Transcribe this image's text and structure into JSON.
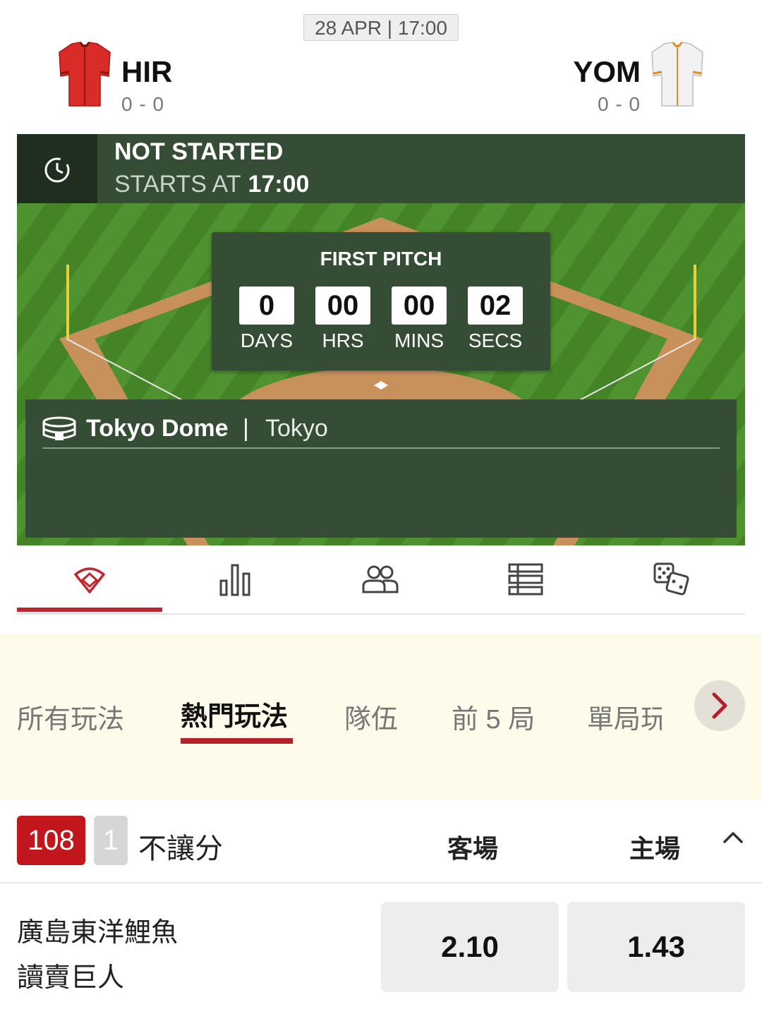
{
  "header": {
    "datetime": "28 APR | 17:00",
    "away_team": {
      "code": "HIR",
      "score": "0 - 0",
      "jersey_color": "#d92b27"
    },
    "home_team": {
      "code": "YOM",
      "score": "0 - 0",
      "jersey_color": "#f2f2f2"
    }
  },
  "status": {
    "title": "NOT STARTED",
    "starts_label": "STARTS AT",
    "start_time": "17:00",
    "icon": "clock-icon"
  },
  "countdown": {
    "title": "FIRST PITCH",
    "units": [
      {
        "value": "0",
        "label": "DAYS"
      },
      {
        "value": "00",
        "label": "HRS"
      },
      {
        "value": "00",
        "label": "MINS"
      },
      {
        "value": "02",
        "label": "SECS"
      }
    ]
  },
  "venue": {
    "name": "Tokyo Dome",
    "separator": "|",
    "city": "Tokyo",
    "icon": "stadium-icon"
  },
  "icon_tabs": [
    {
      "icon": "baseball-field-icon",
      "active": true
    },
    {
      "icon": "bar-chart-icon",
      "active": false
    },
    {
      "icon": "players-icon",
      "active": false
    },
    {
      "icon": "list-icon",
      "active": false
    },
    {
      "icon": "dice-icon",
      "active": false
    }
  ],
  "market_tabs": [
    "所有玩法",
    "熱門玩法",
    "隊伍",
    "前 5 局",
    "單局玩"
  ],
  "market_tabs_active_index": 1,
  "market": {
    "badge_count": "108",
    "badge_secondary": "1",
    "title": "不讓分",
    "col_away": "客場",
    "col_home": "主場"
  },
  "odds": {
    "team_away": "廣島東洋鯉魚",
    "team_home": "讀賣巨人",
    "away_price": "2.10",
    "home_price": "1.43"
  },
  "colors": {
    "accent_red": "#c0262d",
    "panel_green": "#344d34",
    "field_green": "#4a8a2a",
    "dirt": "#c8915c"
  }
}
